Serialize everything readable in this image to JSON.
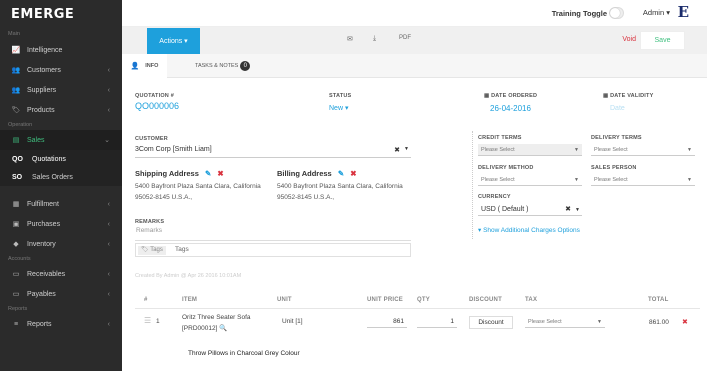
{
  "app": {
    "logo": "EMERGE"
  },
  "sidebar": {
    "section_main": "Main",
    "section_operation": "Operation",
    "section_accounts": "Accounts",
    "section_reports": "Reports",
    "items": [
      {
        "label": "Intelligence",
        "icon": "chart-line-icon"
      },
      {
        "label": "Customers",
        "icon": "users-icon"
      },
      {
        "label": "Suppliers",
        "icon": "suppliers-icon"
      },
      {
        "label": "Products",
        "icon": "tag-icon"
      },
      {
        "label": "Sales",
        "icon": "money-icon"
      },
      {
        "label": "Fulfillment",
        "icon": "box-icon"
      },
      {
        "label": "Purchases",
        "icon": "cart-icon"
      },
      {
        "label": "Inventory",
        "icon": "inventory-icon"
      },
      {
        "label": "Receivables",
        "icon": "receivables-icon"
      },
      {
        "label": "Payables",
        "icon": "payables-icon"
      },
      {
        "label": "Reports",
        "icon": "list-icon"
      }
    ],
    "sub_items": [
      {
        "abbr": "QO",
        "label": "Quotations"
      },
      {
        "abbr": "SO",
        "label": "Sales Orders"
      }
    ]
  },
  "topbar": {
    "training_label": "Training Toggle",
    "user_label": "Admin ▾",
    "brand_mark": "E"
  },
  "actionbar": {
    "actions_label": "Actions ▾",
    "void_label": "Void",
    "save_label": "Save",
    "pdf_label": "PDF"
  },
  "tabs": {
    "info_label": "INFO",
    "tasks_label": "TASKS & NOTES",
    "tasks_count": "0"
  },
  "quotation": {
    "number_label": "QUOTATION #",
    "number": "QO000006",
    "status_label": "STATUS",
    "status": "New ▾",
    "date_ordered_label": "DATE ORDERED",
    "date_ordered": "26-04-2016",
    "date_validity_label": "DATE VALIDITY",
    "date_validity_placeholder": "Date",
    "customer_label": "CUSTOMER",
    "customer": "3Com Corp [Smith Liam]",
    "shipping_label": "Shipping Address",
    "shipping_line1": "5400 Bayfront Plaza Santa Clara, California",
    "shipping_line2": "95052-8145 U.S.A.,",
    "billing_label": "Billing Address",
    "billing_line1": "5400 Bayfront Plaza Santa Clara, California",
    "billing_line2": "95052-8145 U.S.A.,",
    "remarks_label": "REMARKS",
    "remarks_placeholder": "Remarks",
    "tags_pill": "Tags",
    "tags_placeholder": "Tags",
    "credit_terms_label": "CREDIT TERMS",
    "credit_terms": "Please Select",
    "delivery_terms_label": "DELIVERY TERMS",
    "delivery_terms": "Please Select",
    "delivery_method_label": "DELIVERY METHOD",
    "delivery_method": "Please Select",
    "sales_person_label": "SALES PERSON",
    "sales_person": "Please Select",
    "currency_label": "CURRENCY",
    "currency": "USD ( Default )",
    "show_charges": "Show Additional Charges Options",
    "created_by": "Created By Admin @ Apr 26 2016 10:01AM"
  },
  "line_items": {
    "headers": {
      "num": "#",
      "item": "ITEM",
      "unit": "UNIT",
      "unit_price": "UNIT PRICE",
      "qty": "QTY",
      "discount": "DISCOUNT",
      "tax": "TAX",
      "total": "TOTAL"
    },
    "rows": [
      {
        "num": "1",
        "item_line1": "Oritz Three Seater Sofa",
        "item_line2": "[PRD00012]",
        "unit": "Unit [1]",
        "unit_price": "861",
        "qty": "1",
        "discount": "Discount",
        "tax": "Please Select",
        "total": "861.00",
        "description": "Throw Pillows in Charcoal Grey Colour"
      }
    ]
  },
  "colors": {
    "accent": "#1ea0dc",
    "sidebar_bg": "#2b2b2b",
    "active_green": "#3fbf7f",
    "danger": "#d9333f"
  }
}
